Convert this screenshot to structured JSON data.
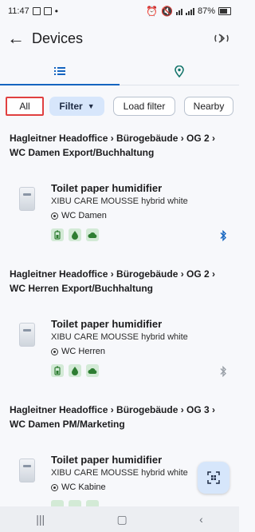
{
  "status_bar": {
    "time": "11:47",
    "battery": "87%"
  },
  "appbar": {
    "title": "Devices",
    "back_icon": "arrow-left-icon",
    "bluetooth_icon": "bluetooth-scan-icon"
  },
  "tabs": [
    {
      "name": "list-tab",
      "icon": "list-icon",
      "active": true
    },
    {
      "name": "map-tab",
      "icon": "location-pin-icon",
      "active": false
    }
  ],
  "chips": {
    "all": "All",
    "filter": "Filter",
    "load_filter": "Load filter",
    "nearby": "Nearby"
  },
  "sections": [
    {
      "heading": "Hagleitner Headoffice › Bürogebäude › OG 2 › WC Damen Export/Buchhaltung",
      "device": {
        "name": "Toilet paper humidifier",
        "model": "XIBU CARE MOUSSE hybrid white",
        "location": "WC Damen",
        "bluetooth_color": "#1565c0"
      }
    },
    {
      "heading": "Hagleitner Headoffice › Bürogebäude › OG 2 › WC Herren Export/Buchhaltung",
      "device": {
        "name": "Toilet paper humidifier",
        "model": "XIBU CARE MOUSSE hybrid white",
        "location": "WC Herren",
        "bluetooth_color": "#9aa0a8"
      }
    },
    {
      "heading": "Hagleitner Headoffice › Bürogebäude › OG 3 › WC Damen PM/Marketing",
      "device": {
        "name": "Toilet paper humidifier",
        "model": "XIBU CARE MOUSSE hybrid white",
        "location": "WC Kabine",
        "bluetooth_color": "#1565c0"
      }
    }
  ],
  "colors": {
    "accent": "#1565c0",
    "chip_highlight": "#e04040",
    "badge_bg": "#d3ead6",
    "badge_fg": "#2e7d32"
  }
}
